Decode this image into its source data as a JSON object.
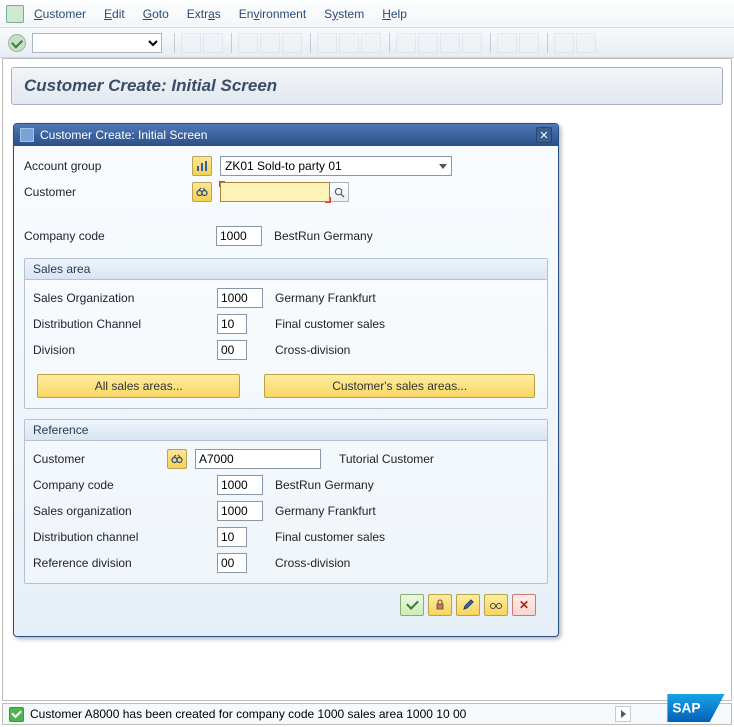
{
  "menubar": {
    "items": [
      "Customer",
      "Edit",
      "Goto",
      "Extras",
      "Environment",
      "System",
      "Help"
    ]
  },
  "title": "Customer Create: Initial Screen",
  "dialog": {
    "title": "Customer Create: Initial Screen",
    "account_group_label": "Account group",
    "account_group_value": "ZK01 Sold-to party 01",
    "customer_label": "Customer",
    "customer_value": "",
    "company_code_label": "Company code",
    "company_code_value": "1000",
    "company_code_desc": "BestRun Germany",
    "sales_area": {
      "title": "Sales area",
      "sales_org_label": "Sales Organization",
      "sales_org_value": "1000",
      "sales_org_desc": "Germany Frankfurt",
      "dist_channel_label": "Distribution Channel",
      "dist_channel_value": "10",
      "dist_channel_desc": "Final customer sales",
      "division_label": "Division",
      "division_value": "00",
      "division_desc": "Cross-division",
      "all_sales_areas_btn": "All sales areas...",
      "cust_sales_areas_btn": "Customer's sales areas..."
    },
    "reference": {
      "title": "Reference",
      "customer_label": "Customer",
      "customer_value": "A7000",
      "customer_desc": "Tutorial Customer",
      "company_code_label": "Company code",
      "company_code_value": "1000",
      "company_code_desc": "BestRun Germany",
      "sales_org_label": "Sales organization",
      "sales_org_value": "1000",
      "sales_org_desc": "Germany Frankfurt",
      "dist_channel_label": "Distribution channel",
      "dist_channel_value": "10",
      "dist_channel_desc": "Final customer sales",
      "ref_division_label": "Reference division",
      "ref_division_value": "00",
      "ref_division_desc": "Cross-division"
    }
  },
  "status_message": "Customer A8000 has been created for company code 1000 sales area 1000 10 00"
}
